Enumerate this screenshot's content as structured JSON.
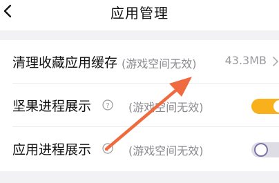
{
  "header": {
    "title": "应用管理"
  },
  "settings": {
    "rows": [
      {
        "label": "清理收藏应用缓存",
        "note": "(游戏空间无效)",
        "value": "43.3MB"
      },
      {
        "label": "坚果进程展示",
        "note": "(游戏空间无效)",
        "toggle_on": true
      },
      {
        "label": "应用进程展示",
        "note": "(游戏空间无效)",
        "toggle_on": false
      }
    ]
  },
  "colors": {
    "toggle_on": "#f8b11c",
    "toggle_off": "#dedde6",
    "annotation_arrow": "#f06a3f"
  }
}
